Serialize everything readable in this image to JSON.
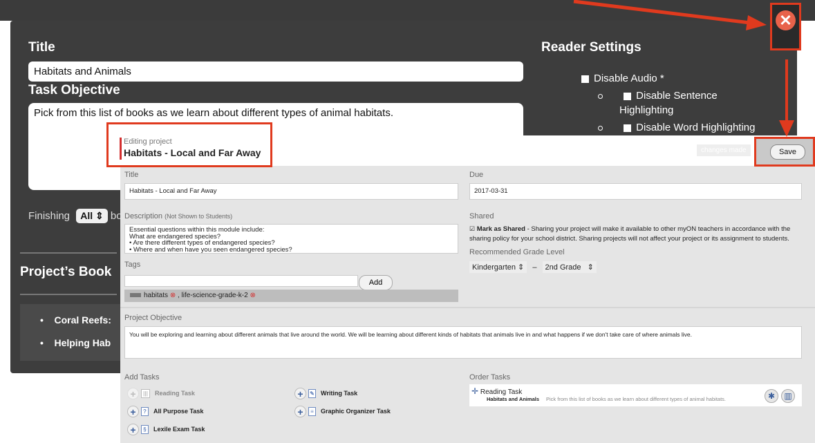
{
  "modal": {
    "title_label": "Title",
    "title_value": "Habitats and Animals",
    "objective_label": "Task Objective",
    "objective_value": "Pick from this list of books as we learn about different types of animal habitats.",
    "reader_settings": "Reader Settings",
    "disable_audio": "Disable Audio *",
    "disable_sentence_1": "Disable Sentence",
    "disable_sentence_2": "Highlighting",
    "disable_word": "Disable Word Highlighting",
    "finishing": "Finishing",
    "finishing_select": "All",
    "finishing_trunc": "bo",
    "books_heading": "Project’s Book",
    "book_1": "Coral Reefs:",
    "book_2": "Helping Hab",
    "close_icon": "close-x-icon"
  },
  "editor": {
    "editing_label": "Editing project",
    "project_name": "Habitats - Local and Far Away",
    "changes_made": "changes made",
    "save_label": "Save",
    "title_label": "Title",
    "title_value": "Habitats - Local and Far Away",
    "due_label": "Due",
    "due_value": "2017-03-31",
    "description_label": "Description",
    "description_note": "(Not Shown to Students)",
    "description_lines": [
      "Essential questions within this module include:",
      "What are endangered species?",
      "• Are there different types of endangered species?",
      "• Where and when have you seen endangered species?"
    ],
    "shared_label": "Shared",
    "mark_shared": "Mark as Shared",
    "shared_text_1": "- Sharing your project will make it available to other myON teachers in accordance with the",
    "shared_text_2": "sharing policy for your school district. Sharing projects will not affect your project or its assignment to students.",
    "grade_label": "Recommended Grade Level",
    "grade_from": "Kindergarten",
    "grade_dash": "–",
    "grade_to": "2nd Grade",
    "tags_label": "Tags",
    "add_label": "Add",
    "tags_list": [
      "habitats",
      "life-science-grade-k-2"
    ],
    "objective_label": "Project Objective",
    "objective_value": "You will be exploring and learning about different animals that live around the world.  We will be learning about different kinds of habitats that animals live in and what happens if we don't take care of where animals live.",
    "add_tasks_label": "Add Tasks",
    "tasks": {
      "reading": "Reading Task",
      "writing": "Writing Task",
      "all_purpose": "All Purpose Task",
      "graphic_organizer": "Graphic Organizer Task",
      "lexile_exam": "Lexile Exam Task"
    },
    "order_tasks_label": "Order Tasks",
    "order_task": {
      "type": "Reading Task",
      "title": "Habitats and Animals",
      "description": "Pick from this list of books as we learn about different types of animal habitats."
    }
  },
  "colors": {
    "annotation_red": "#e03a1e",
    "modal_bg": "#3d3d3d",
    "panel_bg": "#e5e5e5",
    "accent_blue": "#3a5e9c"
  }
}
